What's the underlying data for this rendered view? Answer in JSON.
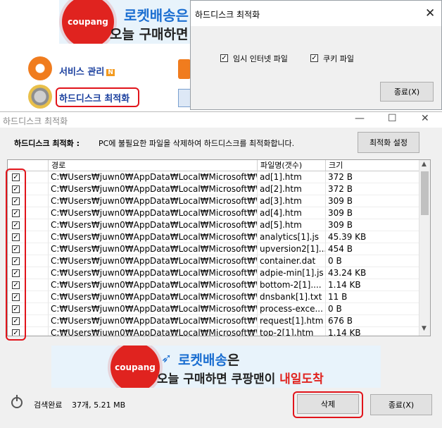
{
  "background_app": {
    "banner": {
      "brand": "coupang",
      "rocket": "로켓배송은",
      "sub": "오늘 구매하면 쿠"
    },
    "menu": [
      {
        "label": "서비스 관리",
        "badge": "N"
      },
      {
        "label": "하드디스크 최적화"
      }
    ]
  },
  "popup": {
    "title": "하드디스크 최적화",
    "close_glyph": "✕",
    "options": [
      {
        "label": "임시 인터넷 파일",
        "checked": true
      },
      {
        "label": "쿠키 파일",
        "checked": true
      }
    ],
    "close_button": "종료(X)"
  },
  "window": {
    "title": "하드디스크 최적화",
    "controls": {
      "minimize": "—",
      "maximize": "☐",
      "close": "✕"
    },
    "header_label": "하드디스크 최적화 :",
    "description": "PC에 불필요한 파일을 삭제하여 하드디스크를 최적화합니다.",
    "settings_button": "최적화 설정",
    "grid": {
      "columns": [
        "경로",
        "파일명(갯수)",
        "크기"
      ],
      "rows": [
        {
          "checked": true,
          "path": "C:₩Users₩juwn0₩AppData₩Local₩Microsoft₩W...",
          "name": "ad[1].htm",
          "size": "372 B"
        },
        {
          "checked": true,
          "path": "C:₩Users₩juwn0₩AppData₩Local₩Microsoft₩W...",
          "name": "ad[2].htm",
          "size": "372 B"
        },
        {
          "checked": true,
          "path": "C:₩Users₩juwn0₩AppData₩Local₩Microsoft₩W...",
          "name": "ad[3].htm",
          "size": "309 B"
        },
        {
          "checked": true,
          "path": "C:₩Users₩juwn0₩AppData₩Local₩Microsoft₩W...",
          "name": "ad[4].htm",
          "size": "309 B"
        },
        {
          "checked": true,
          "path": "C:₩Users₩juwn0₩AppData₩Local₩Microsoft₩W...",
          "name": "ad[5].htm",
          "size": "309 B"
        },
        {
          "checked": true,
          "path": "C:₩Users₩juwn0₩AppData₩Local₩Microsoft₩W...",
          "name": "analytics[1].js",
          "size": "45.39 KB"
        },
        {
          "checked": true,
          "path": "C:₩Users₩juwn0₩AppData₩Local₩Microsoft₩W...",
          "name": "upversion2[1]....",
          "size": "454 B"
        },
        {
          "checked": true,
          "path": "C:₩Users₩juwn0₩AppData₩Local₩Microsoft₩W...",
          "name": "container.dat",
          "size": "0 B"
        },
        {
          "checked": true,
          "path": "C:₩Users₩juwn0₩AppData₩Local₩Microsoft₩W...",
          "name": "adpie-min[1].js",
          "size": "43.24 KB"
        },
        {
          "checked": true,
          "path": "C:₩Users₩juwn0₩AppData₩Local₩Microsoft₩W...",
          "name": "bottom-2[1]....",
          "size": "1.14 KB"
        },
        {
          "checked": true,
          "path": "C:₩Users₩juwn0₩AppData₩Local₩Microsoft₩W...",
          "name": "dnsbank[1].txt",
          "size": "11 B"
        },
        {
          "checked": true,
          "path": "C:₩Users₩juwn0₩AppData₩Local₩Microsoft₩W...",
          "name": "process-exce...",
          "size": "0 B"
        },
        {
          "checked": true,
          "path": "C:₩Users₩juwn0₩AppData₩Local₩Microsoft₩W...",
          "name": "request[1].htm",
          "size": "676 B"
        },
        {
          "checked": true,
          "path": "C:₩Users₩juwn0₩AppData₩Local₩Microsoft₩W...",
          "name": "top-2[1].htm",
          "size": "1.14 KB"
        }
      ]
    },
    "ad": {
      "brand": "coupang",
      "rocket": "로켓배송",
      "rocket_suffix": "은",
      "line2_a": "오늘 구매하면 쿠팡맨이 ",
      "line2_b": "내일도착"
    },
    "status": {
      "label": "검색완료",
      "value": "37개, 5.21 MB"
    },
    "delete_button": "삭제",
    "close_button": "종료(X)"
  },
  "colors": {
    "highlight": "#e1141b",
    "brand_red": "#e0231f",
    "rocket_blue": "#1c6fd1",
    "menu_blue": "#1a3f9e"
  }
}
